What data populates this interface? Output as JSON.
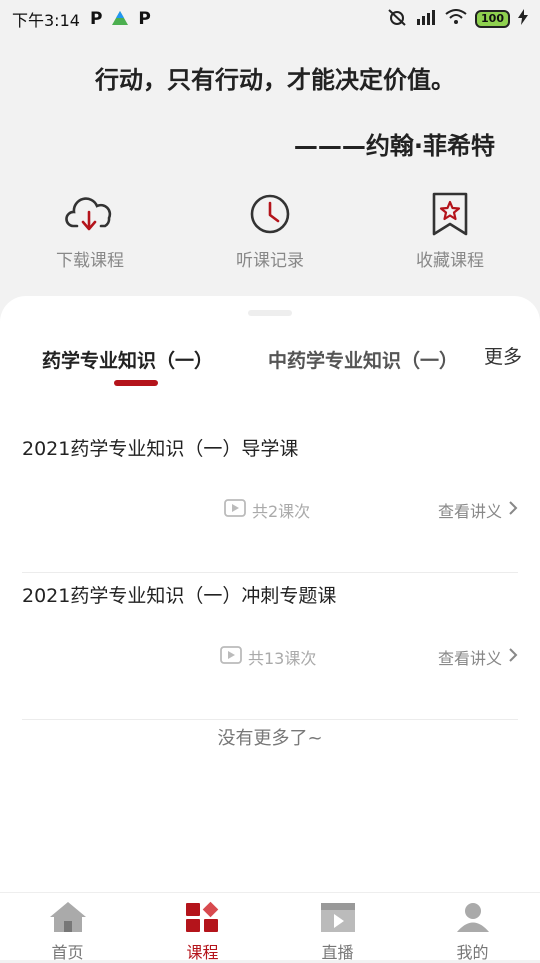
{
  "status_bar": {
    "time": "下午3:14",
    "app_icons": [
      "P",
      "P"
    ],
    "battery": "100"
  },
  "quote": {
    "text": "行动，只有行动，才能决定价值。",
    "author": "———约翰·菲希特"
  },
  "quick_actions": [
    {
      "label": "下载课程",
      "icon": "cloud-download-icon"
    },
    {
      "label": "听课记录",
      "icon": "clock-icon"
    },
    {
      "label": "收藏课程",
      "icon": "bookmark-star-icon"
    }
  ],
  "tabs": {
    "active": "药学专业知识（一）",
    "second": "中药学专业知识（一）",
    "more": "更多"
  },
  "courses": [
    {
      "title": "2021药学专业知识（一）导学课",
      "count": "共2课次",
      "notes": "查看讲义"
    },
    {
      "title": "2021药学专业知识（一）冲刺专题课",
      "count": "共13课次",
      "notes": "查看讲义"
    }
  ],
  "no_more": "没有更多了~",
  "bottom_nav": [
    {
      "label": "首页",
      "icon": "home-icon"
    },
    {
      "label": "课程",
      "icon": "courses-icon"
    },
    {
      "label": "直播",
      "icon": "live-video-icon"
    },
    {
      "label": "我的",
      "icon": "profile-icon"
    }
  ],
  "colors": {
    "accent": "#b4141b",
    "background": "#f2f2f2"
  }
}
